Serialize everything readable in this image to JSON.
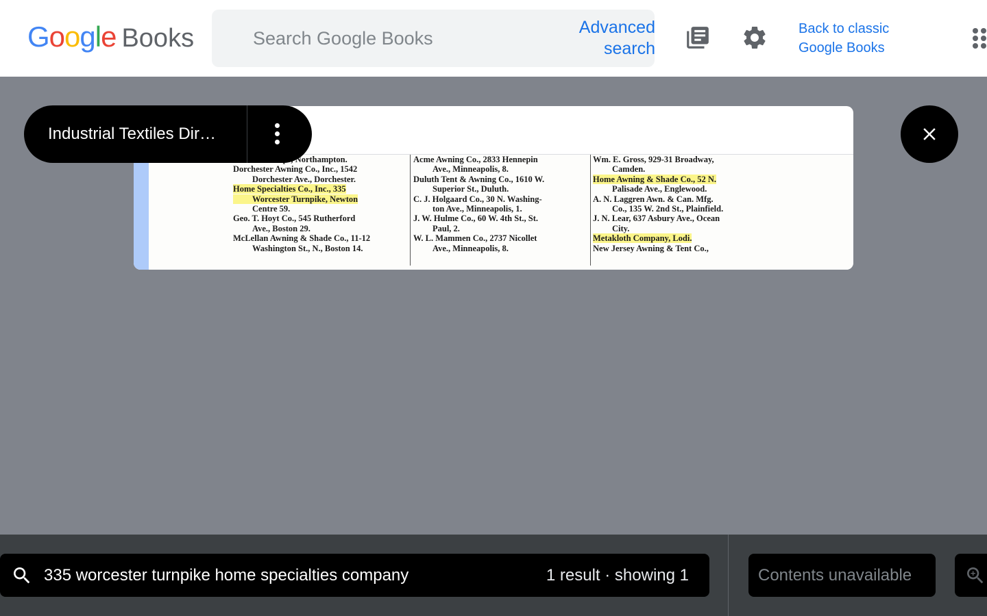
{
  "header": {
    "logo_google_letters": [
      "G",
      "o",
      "o",
      "g",
      "l",
      "e"
    ],
    "logo_books": "Books",
    "search_placeholder": "Search Google Books",
    "advanced_search_line1": "Advanced",
    "advanced_search_line2": "search",
    "classic_link_line1": "Back to classic",
    "classic_link_line2": "Google Books",
    "icons": [
      "library-icon",
      "settings-icon",
      "apps-icon"
    ]
  },
  "viewer": {
    "book_title": "Industrial Textiles Dir…",
    "menu_icon": "more-vert-icon",
    "close_icon": "close-icon",
    "page": {
      "columns": [
        {
          "entries": [
            {
              "lines": [
                "Chilson's Shops, Northampton."
              ]
            },
            {
              "lines": [
                "Dorchester Awning Co., Inc., 1542",
                "Dorchester Ave., Dorchester."
              ]
            },
            {
              "lines": [
                "Home Specialties Co., Inc., 335",
                "Worcester Turnpike, Newton",
                "Centre 59."
              ],
              "highlight": true
            },
            {
              "lines": [
                "Geo. T. Hoyt Co., 545 Rutherford",
                "Ave., Boston 29."
              ]
            },
            {
              "lines": [
                "McLellan Awning & Shade Co., 11-12",
                "Washington St., N., Boston 14."
              ]
            }
          ]
        },
        {
          "entries": [
            {
              "lines": [
                "Acme Awning Co., 2833 Hennepin",
                "Ave., Minneapolis, 8."
              ]
            },
            {
              "lines": [
                "Duluth Tent & Awning Co., 1610 W.",
                "Superior St., Duluth."
              ]
            },
            {
              "lines": [
                "C. J. Holgaard Co., 30 N. Washing-",
                "ton Ave., Minneapolis, 1."
              ]
            },
            {
              "lines": [
                "J. W. Hulme Co., 60 W. 4th St., St.",
                "Paul, 2."
              ]
            },
            {
              "lines": [
                "W. L. Mammen Co., 2737 Nicollet",
                "Ave., Minneapolis, 8."
              ]
            }
          ]
        },
        {
          "entries": [
            {
              "lines": [
                "Wm. E. Gross, 929-31 Broadway,",
                "Camden."
              ]
            },
            {
              "lines": [
                "Home Awning & Shade Co., 52 N.",
                "Palisade Ave., Englewood."
              ]
            },
            {
              "lines": [
                "A. N. Laggren Awn. & Can. Mfg.",
                "Co., 135 W. 2nd St., Plainfield."
              ]
            },
            {
              "lines": [
                "J. N. Lear, 637 Asbury Ave., Ocean",
                "City."
              ]
            },
            {
              "lines": [
                "Metakloth Company, Lodi."
              ]
            },
            {
              "lines": [
                "New Jersey Awning & Tent Co.,"
              ]
            }
          ]
        }
      ]
    }
  },
  "bottom_bar": {
    "search_icon": "search-icon",
    "query": "335 worcester turnpike home specialties company",
    "result_count": "1 result · showing 1",
    "contents_label": "Contents unavailable",
    "zoom_icon": "zoom-in-icon"
  },
  "colors": {
    "header_bg": "#ffffff",
    "viewer_bg": "#80848c",
    "link_blue": "#1a73e8",
    "bottom_bar_bg": "#3c4043",
    "highlight": "#fbf58a"
  }
}
